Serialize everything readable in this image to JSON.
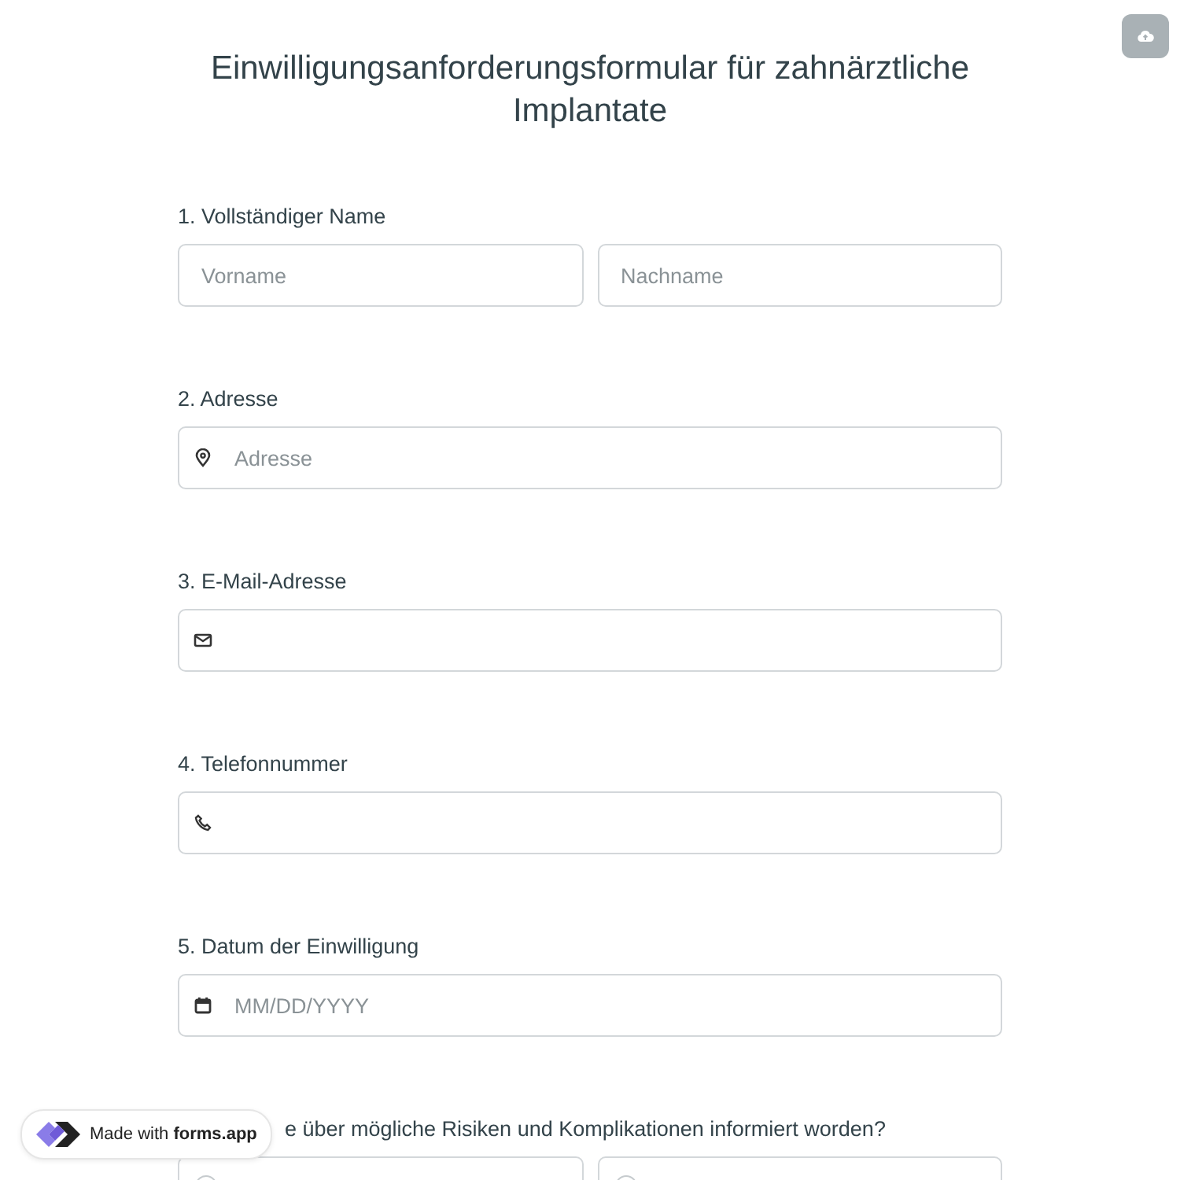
{
  "title": "Einwilligungsanforderungsformular für zahnärztliche Implantate",
  "questions": [
    {
      "kind": "name",
      "number": "1.",
      "label": "Vollständiger Name",
      "fields": [
        {
          "placeholder": "Vorname"
        },
        {
          "placeholder": "Nachname"
        }
      ]
    },
    {
      "kind": "address",
      "number": "2.",
      "label": "Adresse",
      "fields": [
        {
          "placeholder": "Adresse"
        }
      ]
    },
    {
      "kind": "email",
      "number": "3.",
      "label": "E-Mail-Adresse"
    },
    {
      "kind": "phone",
      "number": "4.",
      "label": "Telefonnummer"
    },
    {
      "kind": "date",
      "number": "5.",
      "label": "Datum der Einwilligung",
      "fields": [
        {
          "placeholder": "MM/DD/YYYY"
        }
      ]
    },
    {
      "kind": "radio",
      "label": "e über mögliche Risiken und Komplikationen informiert worden?",
      "options": [
        {
          "selected": false
        },
        {
          "selected": false
        }
      ]
    }
  ],
  "badge": {
    "prefix": "Made with",
    "brand": "forms.app"
  }
}
